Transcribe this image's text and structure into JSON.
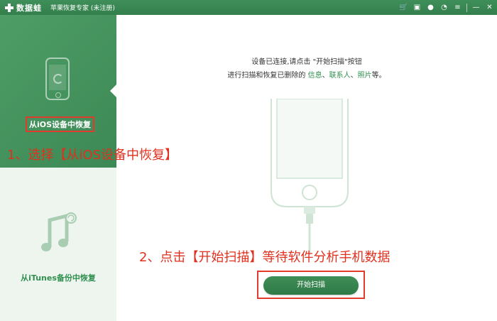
{
  "titlebar": {
    "app_name": "数据蛙",
    "subtitle": "苹果恢复专家 (未注册)",
    "icons": [
      "cart-icon",
      "gift-icon",
      "user-icon",
      "chat-icon",
      "menu-icon",
      "minimize-icon",
      "close-icon"
    ]
  },
  "sidebar": {
    "items": [
      {
        "label": "从iOS设备中恢复",
        "active": true,
        "icon": "phone-refresh-icon"
      },
      {
        "label": "从iTunes备份中恢复",
        "active": false,
        "icon": "music-refresh-icon"
      }
    ]
  },
  "main": {
    "instruction_line1": "设备已连接,请点击 \"开始扫描\"按钮",
    "instruction_line2_prefix": "进行扫描和恢复已删除的 ",
    "instruction_links": [
      "信息",
      "联系人",
      "照片"
    ],
    "instruction_sep": "、",
    "instruction_line2_suffix": "等。",
    "scan_button_label": "开始扫描"
  },
  "annotations": {
    "step1": "1、选择【从iOS设备中恢复】",
    "step2": "2、点击【开始扫描】等待软件分析手机数据"
  },
  "colors": {
    "brand_green": "#3c8955",
    "highlight_red": "#e03b2c",
    "link_green": "#2f8f4e"
  }
}
